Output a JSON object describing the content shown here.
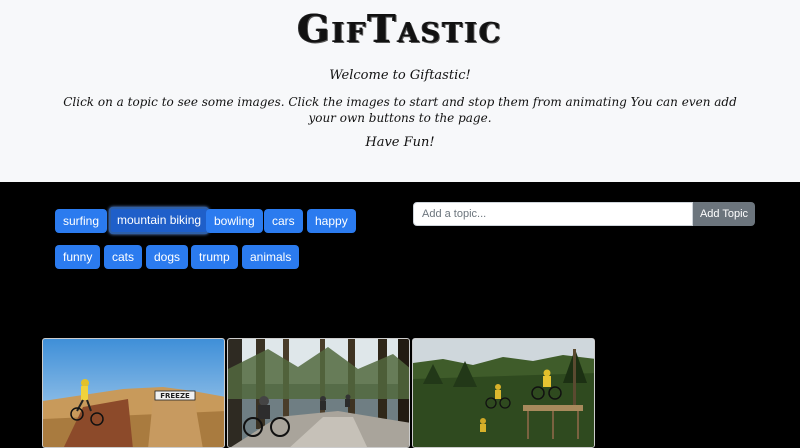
{
  "header": {
    "title": "GifTastic",
    "welcome": "Welcome to Giftastic!",
    "instructions": "Click on a topic to see some images. Click the images to start and stop them from animating You can even add your own buttons to the page.",
    "have_fun": "Have Fun!"
  },
  "topics": [
    "surfing",
    "mountain biking",
    "bowling",
    "cars",
    "happy",
    "funny",
    "cats",
    "dogs",
    "trump",
    "animals"
  ],
  "active_topic": "mountain biking",
  "add_form": {
    "placeholder": "Add a topic...",
    "value": "",
    "button_label": "Add Topic"
  },
  "gifs": [
    {
      "scene": "bmx-ramp-desert",
      "sign_text": "FREEZE"
    },
    {
      "scene": "forest-trail-riders"
    },
    {
      "scene": "wooden-drop-forest"
    }
  ],
  "colors": {
    "primary": "#2b7bef",
    "secondary": "#6c757d",
    "page_bg": "#000000",
    "header_bg": "#f7f8fa"
  }
}
